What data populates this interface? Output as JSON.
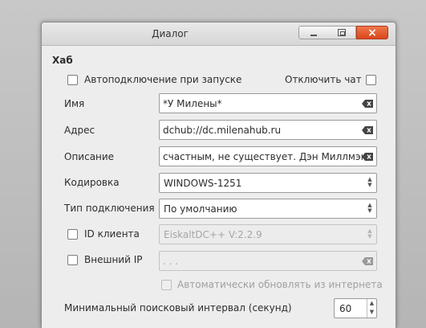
{
  "window": {
    "title": "Диалог",
    "minimize_label": "",
    "maximize_label": "",
    "close_label": "×"
  },
  "hub": {
    "group_title": "Хаб",
    "autoconnect_label": "Автоподключение при запуске",
    "autoconnect_checked": false,
    "disable_chat_label": "Отключить чат",
    "disable_chat_checked": false,
    "name_label": "Имя",
    "name_value": "*У Милены*",
    "address_label": "Адрес",
    "address_value": "dchub://dc.milenahub.ru",
    "description_label": "Описание",
    "description_value": "счастным, не существует. Дэн Миллмэн.",
    "encoding_label": "Кодировка",
    "encoding_value": "WINDOWS-1251",
    "connection_type_label": "Тип подключения",
    "connection_type_value": "По умолчанию",
    "client_id_label": "ID клиента",
    "client_id_checked": false,
    "client_id_value": "EiskaltDC++ V:2.2.9",
    "external_ip_label": "Внешний IP",
    "external_ip_checked": false,
    "external_ip_value": " .  .  .",
    "auto_update_label": "Автоматически обновлять из интернета",
    "auto_update_checked": false,
    "search_interval_label": "Минимальный поисковый интервал (секунд)",
    "search_interval_value": "60"
  },
  "colors": {
    "close_button": "#e0532a",
    "window_bg": "#ededed",
    "disabled_text": "#a6a6a6"
  },
  "icons": {
    "clear": "clear-text-icon",
    "combo_arrows": "up-down-arrows-icon"
  }
}
